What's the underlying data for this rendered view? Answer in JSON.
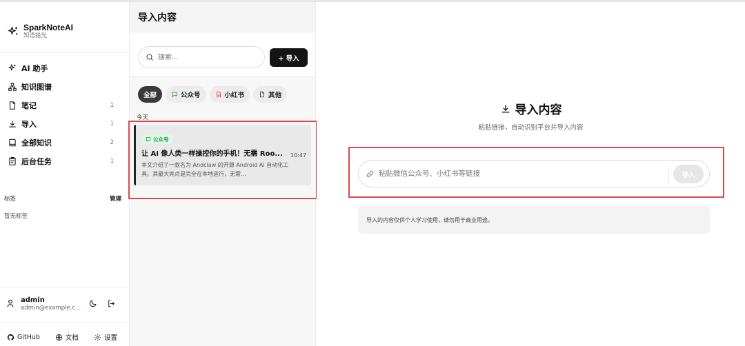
{
  "brand": {
    "name": "SparkNoteAI",
    "subtitle": "知语拾光"
  },
  "nav": [
    {
      "label": "AI 助手",
      "count": ""
    },
    {
      "label": "知识图谱",
      "count": ""
    },
    {
      "label": "笔记",
      "count": "1"
    },
    {
      "label": "导入",
      "count": "1"
    },
    {
      "label": "全部知识",
      "count": "2"
    },
    {
      "label": "后台任务",
      "count": "1"
    }
  ],
  "tags": {
    "label": "标签",
    "manage": "管理",
    "empty": "暂无标签"
  },
  "user": {
    "name": "admin",
    "email": "admin@example.c..."
  },
  "footer": {
    "github": "GitHub",
    "docs": "文档",
    "settings": "设置"
  },
  "list": {
    "title": "导入内容",
    "search_placeholder": "搜索...",
    "import_button": "+ 导入",
    "filters": [
      {
        "label": "全部",
        "active": true
      },
      {
        "label": "公众号",
        "active": false
      },
      {
        "label": "小红书",
        "active": false
      },
      {
        "label": "其他",
        "active": false
      }
    ],
    "group_label": "今天",
    "items": [
      {
        "badge": "公众号",
        "title": "让 AI 像人类一样操控你的手机！无需 Roo...",
        "time": "10:47",
        "description": "本文介绍了一款名为 Andclaw 的开源 Android AI 自动化工具。其最大亮点是完全在本地运行，无需..."
      }
    ]
  },
  "main": {
    "title": "导入内容",
    "subtitle": "粘贴链接，自动识别平台并导入内容",
    "url_placeholder": "粘贴微信公众号、小红书等链接",
    "import_button": "导入",
    "notice": "导入的内容仅供个人学习使用，请勿用于商业用途。"
  },
  "colors": {
    "highlight": "#e04848",
    "badge_green": "#1f9a47",
    "dark_button": "#151515"
  }
}
